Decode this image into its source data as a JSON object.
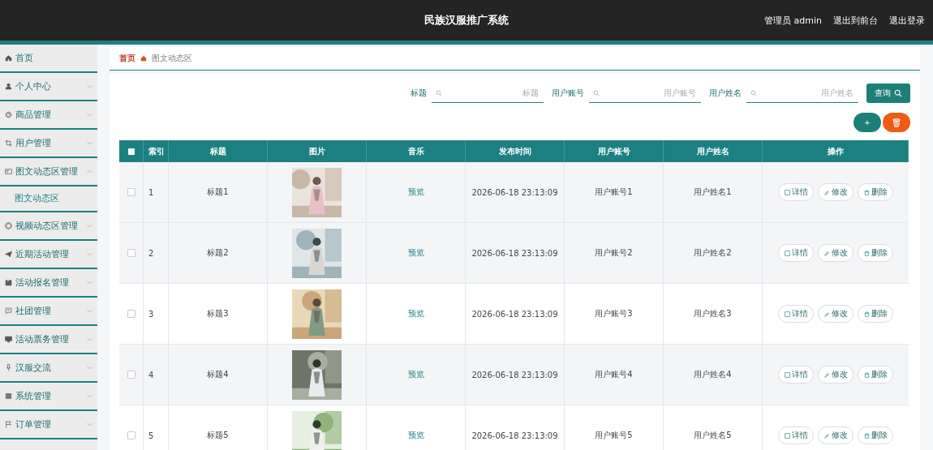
{
  "header": {
    "title": "民族汉服推广系统",
    "user": "管理员 admin",
    "links": [
      "退出到前台",
      "退出登录"
    ]
  },
  "sidebar": {
    "items": [
      {
        "label": "首页",
        "expandable": false
      },
      {
        "label": "个人中心",
        "expandable": true,
        "expanded": false
      },
      {
        "label": "商品管理",
        "expandable": true,
        "expanded": false
      },
      {
        "label": "用户管理",
        "expandable": true,
        "expanded": false
      },
      {
        "label": "图文动态区管理",
        "expandable": true,
        "expanded": true,
        "children": [
          {
            "label": "图文动态区",
            "selected": true
          }
        ]
      },
      {
        "label": "视频动态区管理",
        "expandable": true,
        "expanded": false
      },
      {
        "label": "近期活动管理",
        "expandable": true,
        "expanded": false
      },
      {
        "label": "活动报名管理",
        "expandable": true,
        "expanded": false
      },
      {
        "label": "社团管理",
        "expandable": true,
        "expanded": false
      },
      {
        "label": "活动票务管理",
        "expandable": true,
        "expanded": false
      },
      {
        "label": "汉服交流",
        "expandable": true,
        "expanded": false
      },
      {
        "label": "系统管理",
        "expandable": true,
        "expanded": false
      },
      {
        "label": "订单管理",
        "expandable": true,
        "expanded": false
      }
    ]
  },
  "breadcrumb": [
    "首页",
    "图文动态区"
  ],
  "search": {
    "fields": [
      {
        "label": "标题",
        "placeholder": "标题"
      },
      {
        "label": "用户账号",
        "placeholder": "用户账号"
      },
      {
        "label": "用户姓名",
        "placeholder": "用户姓名"
      }
    ],
    "button": "查询"
  },
  "actions": {
    "add": "+",
    "delete": "🗑"
  },
  "table": {
    "columns": [
      "索引",
      "标题",
      "图片",
      "音乐",
      "发布时间",
      "用户账号",
      "用户姓名",
      "操作"
    ],
    "all_checked": false,
    "rows": [
      {
        "index": "1",
        "title": "标题1",
        "music": "预览",
        "time": "2026-06-18 23:13:09",
        "account": "用户账号1",
        "name": "用户姓名1",
        "checked": false,
        "actions": [
          "详情",
          "修改",
          "删除"
        ]
      },
      {
        "index": "2",
        "title": "标题2",
        "music": "预览",
        "time": "2026-06-18 23:13:09",
        "account": "用户账号2",
        "name": "用户姓名2",
        "checked": false,
        "actions": [
          "详情",
          "修改",
          "删除"
        ]
      },
      {
        "index": "3",
        "title": "标题3",
        "music": "预览",
        "time": "2026-06-18 23:13:09",
        "account": "用户账号3",
        "name": "用户姓名3",
        "checked": false,
        "actions": [
          "详情",
          "修改",
          "删除"
        ]
      },
      {
        "index": "4",
        "title": "标题4",
        "music": "预览",
        "time": "2026-06-18 23:13:09",
        "account": "用户账号4",
        "name": "用户姓名4",
        "checked": false,
        "actions": [
          "详情",
          "修改",
          "删除"
        ]
      },
      {
        "index": "5",
        "title": "标题5",
        "music": "预览",
        "time": "2026-06-18 23:13:09",
        "account": "用户账号5",
        "name": "用户姓名5",
        "checked": false,
        "actions": [
          "详情",
          "修改",
          "删除"
        ]
      }
    ]
  }
}
